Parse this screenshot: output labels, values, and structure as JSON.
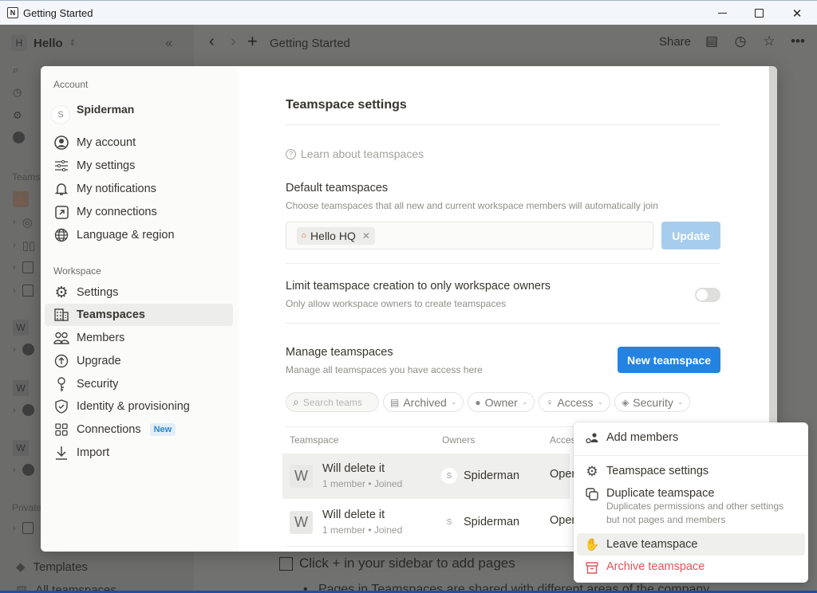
{
  "window": {
    "title": "Getting Started",
    "app_icon": "notion-icon",
    "controls": [
      "minimize",
      "maximize",
      "close"
    ]
  },
  "app": {
    "workspace_badge": "H",
    "workspace_name": "Hello",
    "breadcrumb": "Getting Started",
    "share_label": "Share",
    "background_sidebar": {
      "teamspaces_label": "Teams",
      "private_label": "Private",
      "workspace_badges": [
        "W",
        "W",
        "W"
      ],
      "templates_label": "Templates",
      "all_teamspaces_label": "All teamspaces"
    },
    "background_page": {
      "todo_text": "Click + in your sidebar to add pages",
      "bullet_text": "Pages in Teamspaces are shared with different areas of the company"
    }
  },
  "modal": {
    "sidebar": {
      "account_section": "Account",
      "user": {
        "avatar_letter": "S",
        "name": "Spiderman"
      },
      "account_items": [
        {
          "label": "My account",
          "icon": "user-circle-icon"
        },
        {
          "label": "My settings",
          "icon": "sliders-icon"
        },
        {
          "label": "My notifications",
          "icon": "bell-icon"
        },
        {
          "label": "My connections",
          "icon": "external-link-icon"
        },
        {
          "label": "Language & region",
          "icon": "globe-icon"
        }
      ],
      "workspace_section": "Workspace",
      "workspace_items": [
        {
          "label": "Settings",
          "icon": "gear-icon"
        },
        {
          "label": "Teamspaces",
          "icon": "building-icon",
          "active": true
        },
        {
          "label": "Members",
          "icon": "people-icon"
        },
        {
          "label": "Upgrade",
          "icon": "upgrade-arrow-icon"
        },
        {
          "label": "Security",
          "icon": "key-icon"
        },
        {
          "label": "Identity & provisioning",
          "icon": "shield-check-icon"
        },
        {
          "label": "Connections",
          "icon": "grid-icon",
          "badge": "New"
        },
        {
          "label": "Import",
          "icon": "download-icon"
        }
      ]
    },
    "content": {
      "title": "Teamspace settings",
      "learn_link": "Learn about teamspaces",
      "default_teamspaces": {
        "title": "Default teamspaces",
        "description": "Choose teamspaces that all new and current workspace members will automatically join",
        "tags": [
          "Hello HQ"
        ],
        "update_label": "Update"
      },
      "limit_creation": {
        "title": "Limit teamspace creation to only workspace owners",
        "description": "Only allow workspace owners to create teamspaces",
        "enabled": false
      },
      "manage": {
        "title": "Manage teamspaces",
        "description": "Manage all teamspaces you have access here",
        "new_button": "New teamspace",
        "search_placeholder": "Search teams",
        "filters": [
          "Archived",
          "Owner",
          "Access",
          "Security"
        ],
        "columns": [
          "Teamspace",
          "Owners",
          "Access"
        ],
        "rows": [
          {
            "initial": "W",
            "name": "Will delete it",
            "meta": "1 member • Joined",
            "owner_initial": "S",
            "owner": "Spiderman",
            "access": "Open"
          },
          {
            "initial": "W",
            "name": "Will delete it",
            "meta": "1 member • Joined",
            "owner_initial": "S",
            "owner": "Spiderman",
            "access": "Open"
          }
        ]
      }
    }
  },
  "context_menu": {
    "items": [
      {
        "label": "Add members",
        "icon": "add-member-icon"
      },
      {
        "label": "Teamspace settings",
        "icon": "gear-icon"
      },
      {
        "label": "Duplicate teamspace",
        "icon": "duplicate-icon",
        "description": "Duplicates permissions and other settings but not pages and members"
      },
      {
        "label": "Leave teamspace",
        "icon": "wave-hand-icon"
      },
      {
        "label": "Archive teamspace",
        "icon": "archive-icon"
      }
    ],
    "danger_color": "#e0545a"
  },
  "colors": {
    "primary": "#2483e2",
    "primary_disabled": "#a7cdee",
    "home_icon": "#e06a2b",
    "new_badge": "#2a85d0"
  }
}
